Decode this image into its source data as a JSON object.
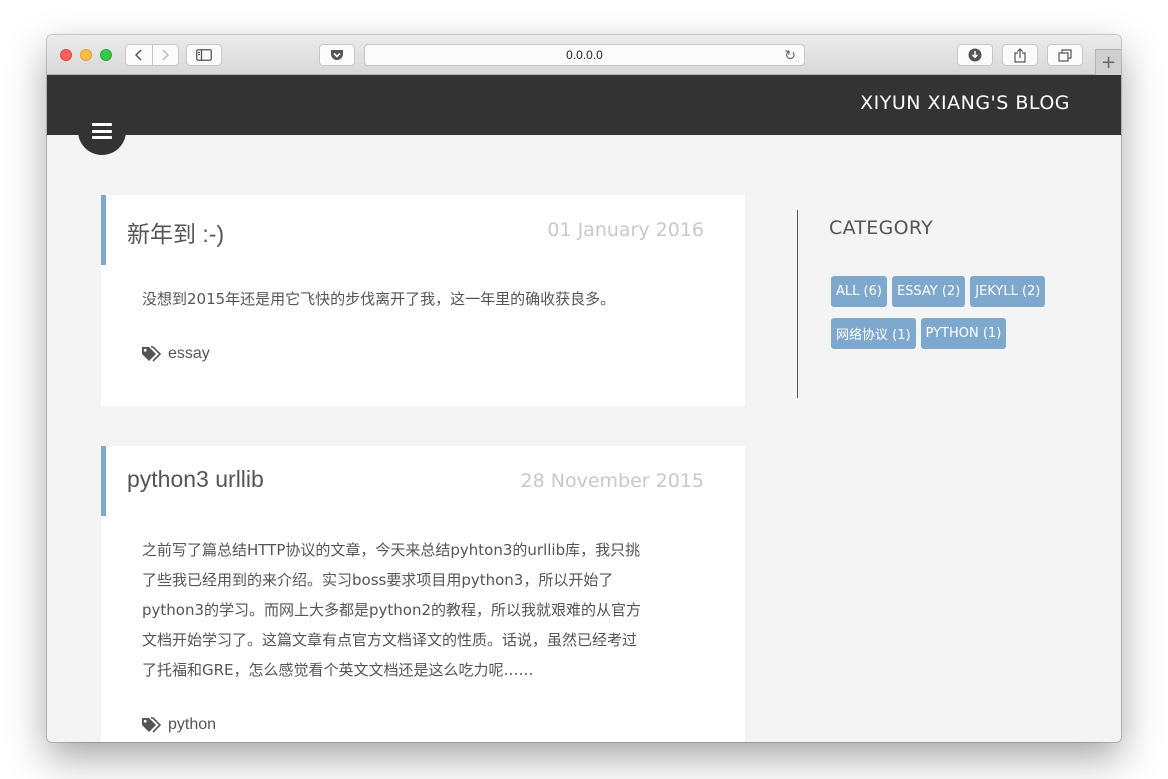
{
  "browser": {
    "url": "0.0.0.0",
    "new_tab_glyph": "+"
  },
  "site": {
    "title": "XIYUN XIANG'S BLOG"
  },
  "posts": [
    {
      "title": "新年到 :-)",
      "date": "01 January 2016",
      "excerpt_lines": [
        "没想到2015年还是用它飞快的步伐离开了我，这一年里的确收获良多。"
      ],
      "tag": "essay"
    },
    {
      "title": "python3 urllib",
      "date": "28 November 2015",
      "excerpt_lines": [
        "之前写了篇总结HTTP协议的文章，今天来总结pyhton3的urllib库，我只挑",
        "了些我已经用到的来介绍。实习boss要求项目用python3，所以开始了",
        "python3的学习。而网上大多都是python2的教程，所以我就艰难的从官方",
        "文档开始学习了。这篇文章有点官方文档译文的性质。话说，虽然已经考过",
        "了托福和GRE，怎么感觉看个英文文档还是这么吃力呢……"
      ],
      "tag": "python"
    }
  ],
  "category": {
    "heading": "CATEGORY",
    "tags": [
      {
        "label": "ALL (6)"
      },
      {
        "label": "ESSAY (2)"
      },
      {
        "label": "JEKYLL (2)"
      },
      {
        "label": "网络协议 (1)"
      },
      {
        "label": "PYTHON (1)"
      }
    ]
  },
  "icons": {
    "menu": "menu-icon",
    "tag": "tags-icon",
    "back": "chevron-left-icon",
    "forward": "chevron-right-icon",
    "sidebar": "sidebar-icon",
    "pocket": "pocket-icon",
    "reload": "reload-icon",
    "download": "download-icon",
    "share": "share-icon",
    "tabs": "tabs-icon"
  },
  "colors": {
    "header_bg": "#333333",
    "accent": "#7fa8cf",
    "page_bg": "#f4f4f4",
    "date_text": "#c9c9c9"
  }
}
